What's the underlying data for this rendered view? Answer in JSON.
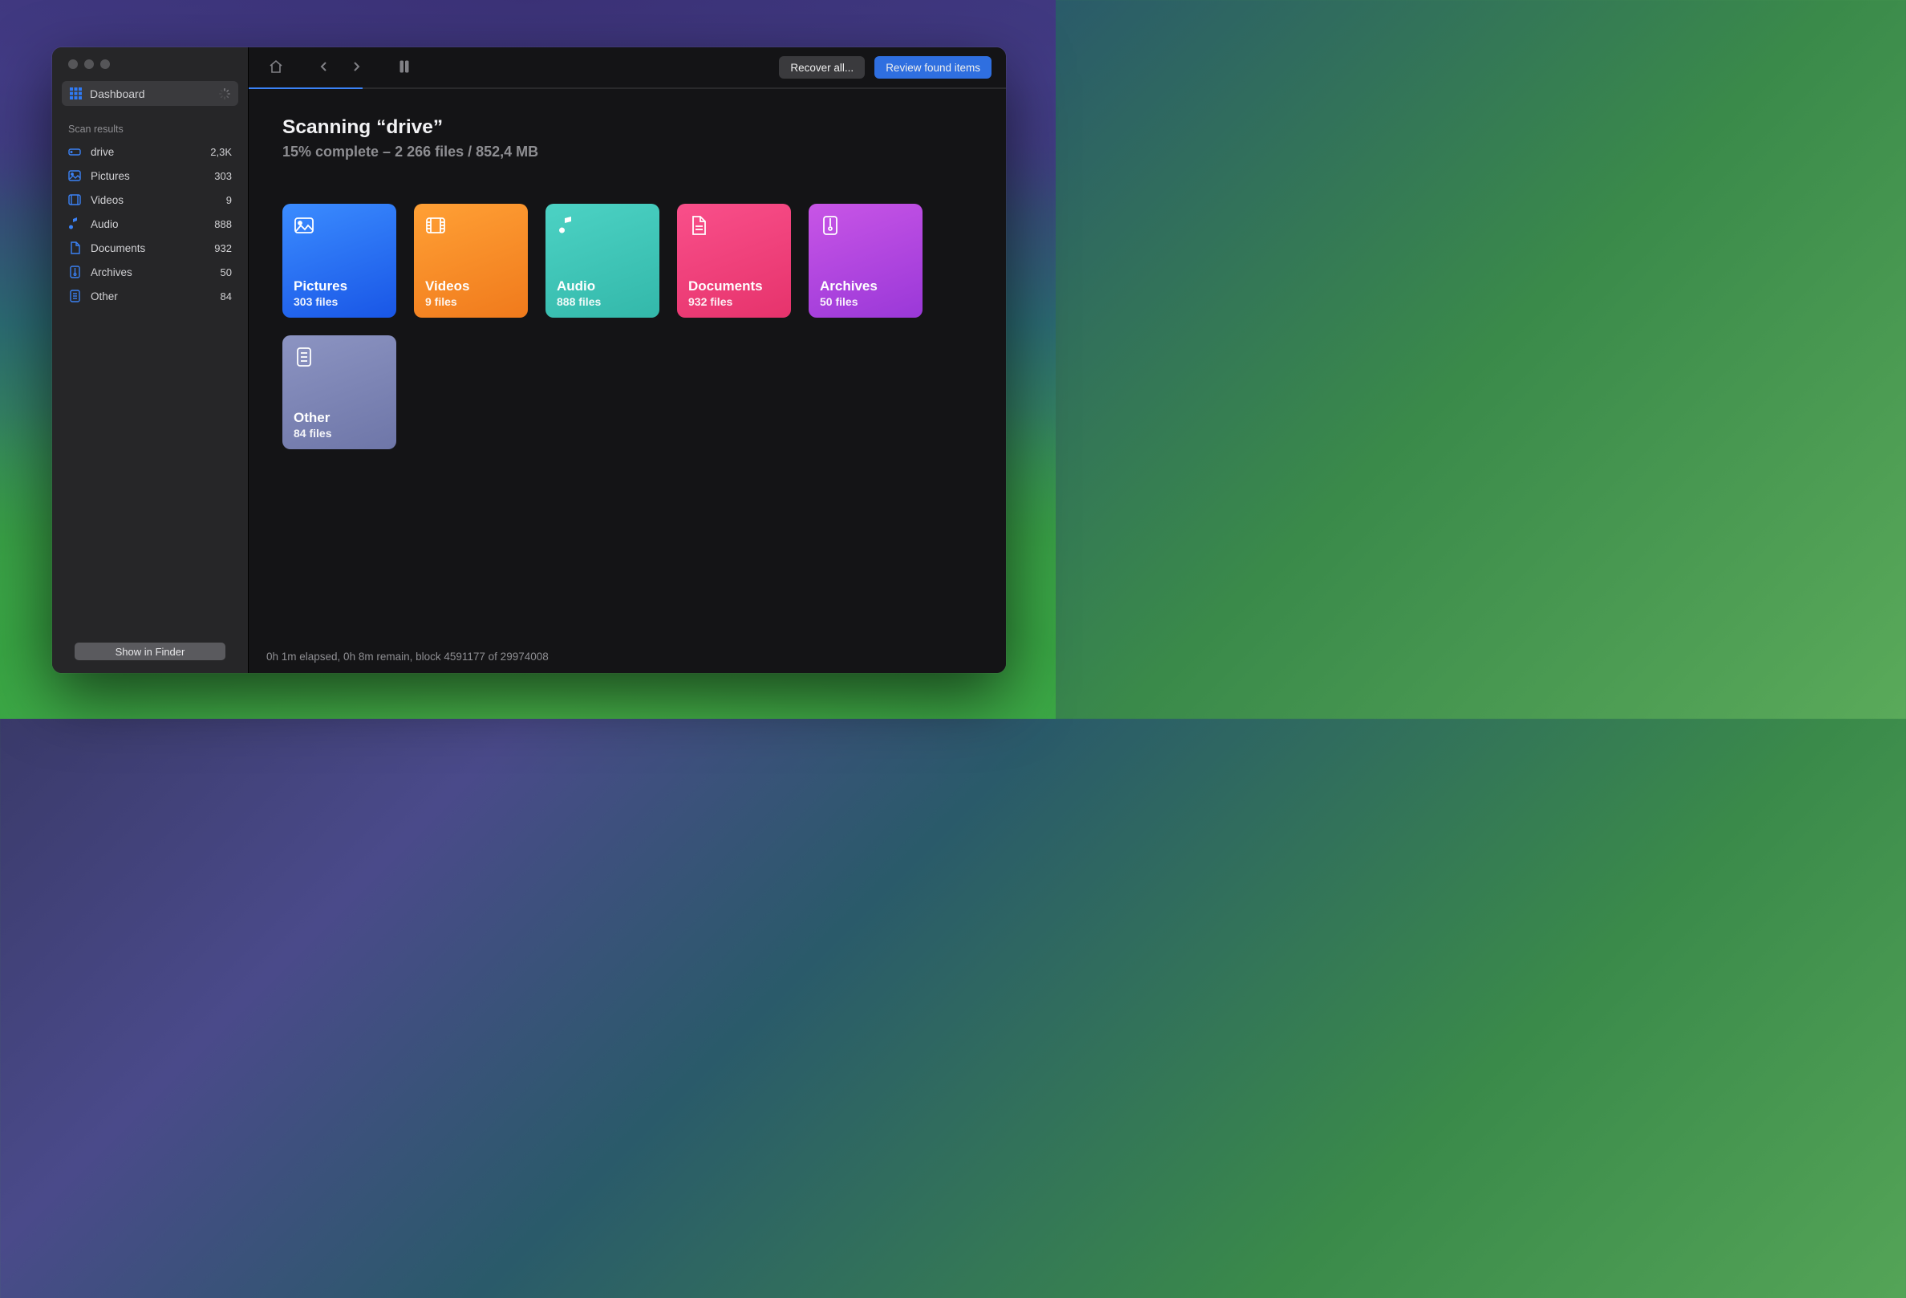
{
  "sidebar": {
    "dashboard_label": "Dashboard",
    "section_header": "Scan results",
    "items": [
      {
        "icon": "harddrive-icon",
        "label": "drive",
        "count": "2,3K"
      },
      {
        "icon": "picture-icon",
        "label": "Pictures",
        "count": "303"
      },
      {
        "icon": "video-icon",
        "label": "Videos",
        "count": "9"
      },
      {
        "icon": "music-icon",
        "label": "Audio",
        "count": "888"
      },
      {
        "icon": "document-icon",
        "label": "Documents",
        "count": "932"
      },
      {
        "icon": "archive-icon",
        "label": "Archives",
        "count": "50"
      },
      {
        "icon": "other-icon",
        "label": "Other",
        "count": "84"
      }
    ],
    "show_in_finder": "Show in Finder"
  },
  "toolbar": {
    "recover_all": "Recover all...",
    "review_found": "Review found items"
  },
  "scan": {
    "title": "Scanning “drive”",
    "subtitle": "15% complete – 2 266 files / 852,4 MB",
    "progress_percent": 15
  },
  "cards": [
    {
      "key": "pictures",
      "title": "Pictures",
      "sub": "303 files"
    },
    {
      "key": "videos",
      "title": "Videos",
      "sub": "9 files"
    },
    {
      "key": "audio",
      "title": "Audio",
      "sub": "888 files"
    },
    {
      "key": "documents",
      "title": "Documents",
      "sub": "932 files"
    },
    {
      "key": "archives",
      "title": "Archives",
      "sub": "50 files"
    },
    {
      "key": "other",
      "title": "Other",
      "sub": "84 files"
    }
  ],
  "status": "0h 1m elapsed, 0h 8m remain, block 4591177 of 29974008"
}
